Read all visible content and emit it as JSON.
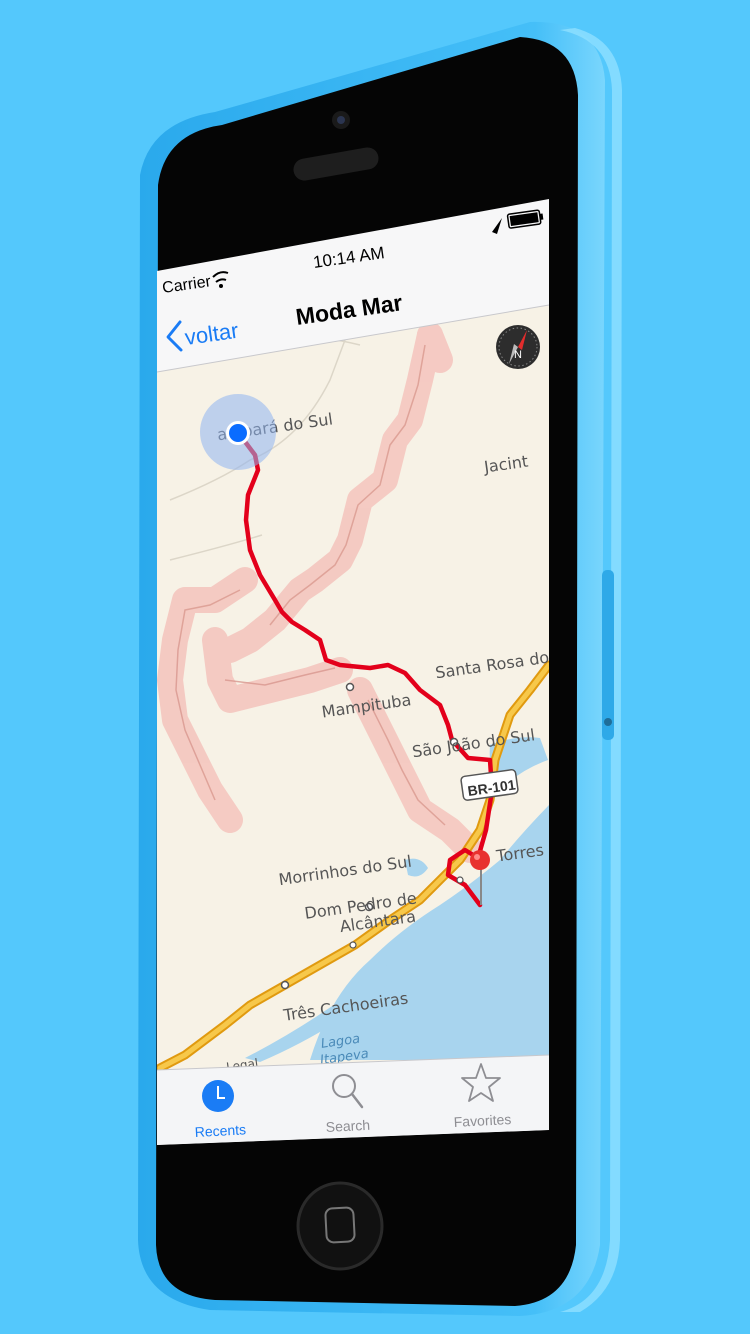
{
  "status_bar": {
    "carrier": "Carrier",
    "time": "10:14 AM"
  },
  "nav_bar": {
    "back_label": "voltar",
    "title": "Moda Mar"
  },
  "map": {
    "labels": [
      "ambará do Sul",
      "Jacint",
      "Mampituba",
      "Santa Rosa do Su",
      "São João do Sul",
      "Morrinhos do Sul",
      "Dom Pedro de",
      "Alcântara",
      "Três Cachoeiras",
      "Lagoa",
      "Itapeva",
      "Torres",
      "Legal"
    ],
    "highway_shield": "BR-101",
    "compass_letter": "N"
  },
  "tab_bar": {
    "items": [
      {
        "label": "Recents",
        "icon": "clock-icon",
        "selected": true
      },
      {
        "label": "Search",
        "icon": "search-icon",
        "selected": false
      },
      {
        "label": "Favorites",
        "icon": "star-icon",
        "selected": false
      }
    ]
  },
  "colors": {
    "background": "#54c8fc",
    "phone_body": "#3fb8f5",
    "route": "#e3001b",
    "tint": "#1a7cf5",
    "user_dot": "#0a6cff",
    "pin": "#e8322f",
    "highway": "#f2b320",
    "water": "#a8d4ee",
    "land": "#f7f2e6",
    "relief": "#f4c6bf"
  }
}
